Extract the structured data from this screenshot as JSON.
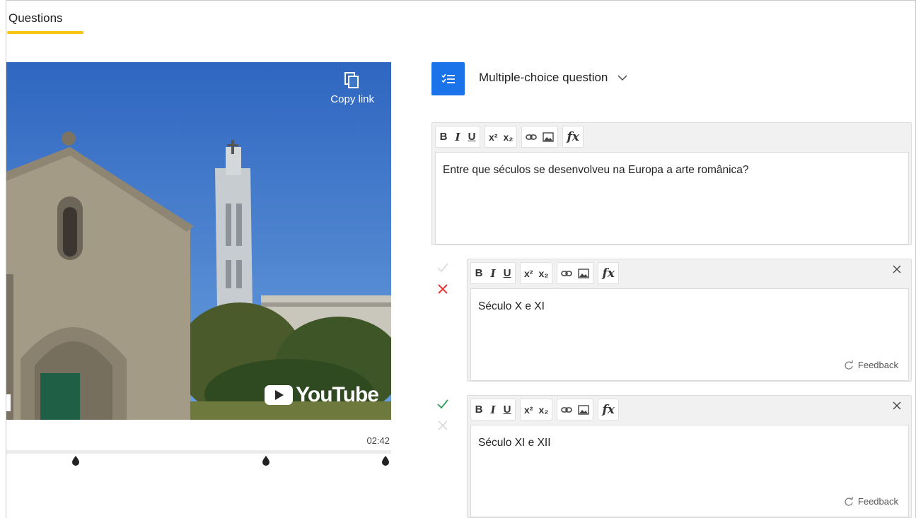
{
  "tabs": {
    "active": "Questions"
  },
  "video": {
    "copy_link": "Copy link",
    "brand": "YouTube",
    "timecode": "02:42",
    "markers": [
      0.18,
      0.675,
      0.985
    ]
  },
  "question": {
    "type_label": "Multiple-choice question",
    "text": "Entre que séculos se desenvolveu na Europa a arte românica?"
  },
  "toolbar": {
    "bold": "B",
    "italic": "I",
    "underline": "U",
    "superscript": "x²",
    "subscript": "x₂",
    "formula": "fx"
  },
  "answers": [
    {
      "text": "Século X e XI",
      "correct": false,
      "feedback_label": "Feedback"
    },
    {
      "text": "Século XI e XII",
      "correct": true,
      "feedback_label": "Feedback"
    }
  ],
  "colors": {
    "accent": "#1a73e8",
    "tab_underline": "#f6c415",
    "wrong": "#e53935",
    "right": "#2e9e5b"
  }
}
